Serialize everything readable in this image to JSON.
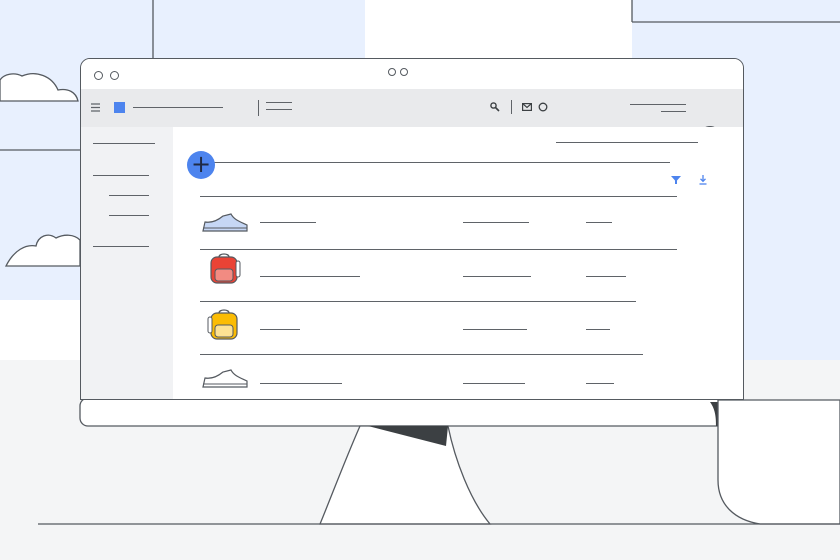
{
  "scene": {
    "colors": {
      "background_blue": "#e8f0fe",
      "outline": "#555a60",
      "accent": "#4d84ee",
      "toolbar": "#e9eaec",
      "sidebar": "#f1f2f4",
      "brand": "#34a853"
    }
  },
  "toolbar": {
    "menu_icon": "hamburger-icon",
    "logo_icon": "square-logo-icon",
    "search_icon": "search-icon",
    "mail_icon": "mail-icon",
    "status_icon": "circle-icon",
    "avatar_icon": "tree-avatar-icon"
  },
  "main": {
    "fab_label": "+",
    "filter_icon": "filter-icon",
    "download_icon": "download-icon",
    "products": [
      {
        "icon": "sneaker-icon",
        "color": "#c6d7f5"
      },
      {
        "icon": "red-backpack-icon",
        "color": "#ea4335"
      },
      {
        "icon": "yellow-backpack-icon",
        "color": "#fbbc04"
      },
      {
        "icon": "sneaker-outline-icon",
        "color": "#ffffff"
      }
    ]
  }
}
